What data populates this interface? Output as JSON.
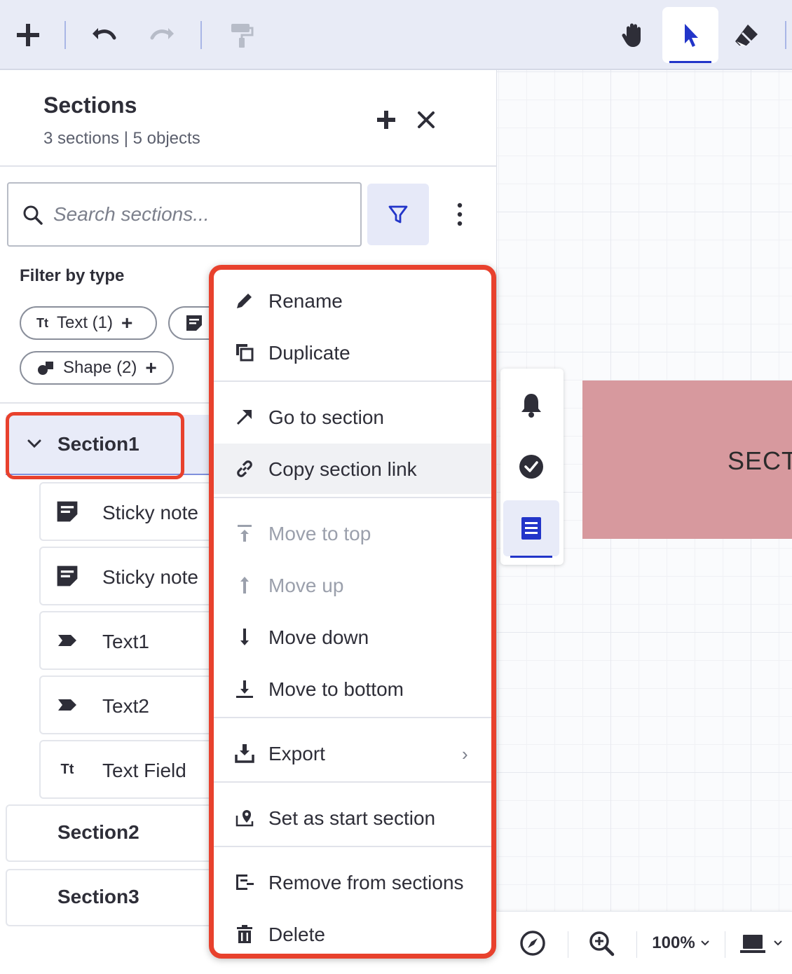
{
  "toolbar": {
    "tools": [
      "add",
      "undo",
      "redo",
      "format-painter",
      "pan-hand",
      "select-pointer",
      "eraser"
    ],
    "active_tool": "select-pointer",
    "accent": "#2235c9"
  },
  "panel": {
    "title": "Sections",
    "subtitle": "3 sections | 5 objects",
    "search_placeholder": "Search sections...",
    "filter_label": "Filter by type",
    "chips": [
      {
        "label": "Text (1)",
        "icon": "text-tt-icon"
      },
      {
        "label": "",
        "icon": "sticky-note-icon"
      },
      {
        "label": "Shape (2)",
        "icon": "shape-icon"
      }
    ],
    "sections": [
      {
        "label": "Section1",
        "expanded": true,
        "objects": [
          {
            "label": "Sticky note",
            "icon": "sticky-note-icon"
          },
          {
            "label": "Sticky note",
            "icon": "sticky-note-icon"
          },
          {
            "label": "Text1",
            "icon": "text-tag-icon"
          },
          {
            "label": "Text2",
            "icon": "text-tag-icon"
          },
          {
            "label": "Text Field",
            "icon": "text-tt-icon"
          }
        ]
      },
      {
        "label": "Section2",
        "expanded": false
      },
      {
        "label": "Section3",
        "expanded": false
      }
    ]
  },
  "context_menu": {
    "items": [
      {
        "label": "Rename",
        "icon": "pencil-icon",
        "enabled": true
      },
      {
        "label": "Duplicate",
        "icon": "duplicate-icon",
        "enabled": true
      },
      {
        "label": "Go to section",
        "icon": "arrow-up-right-icon",
        "enabled": true
      },
      {
        "label": "Copy section link",
        "icon": "link-icon",
        "enabled": true,
        "hovered": true
      },
      {
        "label": "Move to top",
        "icon": "move-to-top-icon",
        "enabled": false
      },
      {
        "label": "Move up",
        "icon": "arrow-up-icon",
        "enabled": false
      },
      {
        "label": "Move down",
        "icon": "arrow-down-icon",
        "enabled": true
      },
      {
        "label": "Move to bottom",
        "icon": "move-to-bottom-icon",
        "enabled": true
      },
      {
        "label": "Export",
        "icon": "download-icon",
        "enabled": true,
        "submenu": true
      },
      {
        "label": "Set as start section",
        "icon": "map-pin-icon",
        "enabled": true
      },
      {
        "label": "Remove from sections",
        "icon": "remove-section-icon",
        "enabled": true
      },
      {
        "label": "Delete",
        "icon": "trash-icon",
        "enabled": true
      }
    ],
    "highlight_color": "#e8412d"
  },
  "canvas": {
    "section_shape_label": "SECTI",
    "section_shape_color": "#d7999e",
    "side_tools": [
      "bell-icon",
      "check-circle-icon",
      "sections-list-icon"
    ],
    "zoom_label": "100%"
  }
}
